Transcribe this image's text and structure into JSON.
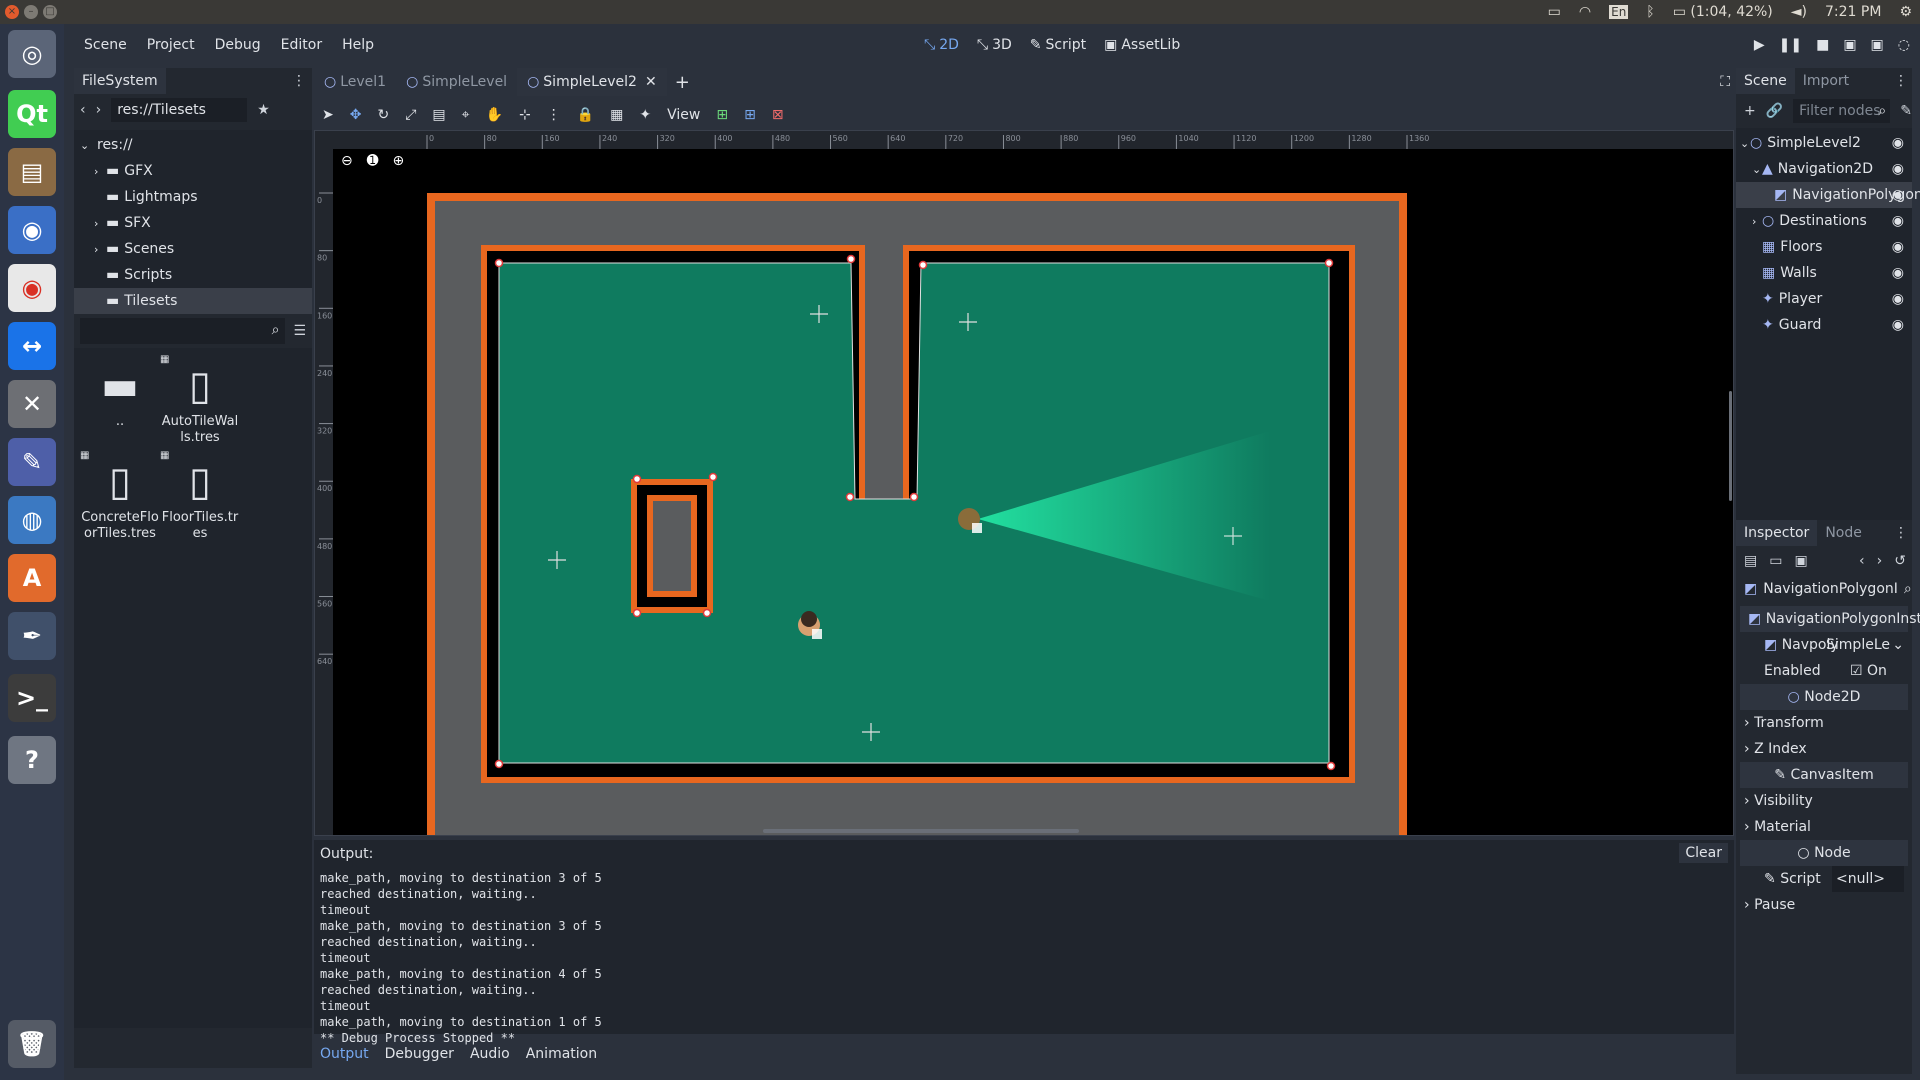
{
  "system": {
    "battery": "(1:04, 42%)",
    "clock": "7:21 PM",
    "keyboard": "En"
  },
  "menu": [
    "Scene",
    "Project",
    "Debug",
    "Editor",
    "Help"
  ],
  "modes": [
    {
      "label": "2D",
      "active": true
    },
    {
      "label": "3D",
      "active": false
    },
    {
      "label": "Script",
      "active": false
    },
    {
      "label": "AssetLib",
      "active": false
    }
  ],
  "filesystem": {
    "tab": "FileSystem",
    "path": "res://Tilesets",
    "tree": [
      {
        "label": "res://",
        "level": 0,
        "expanded": true,
        "selected": false
      },
      {
        "label": "GFX",
        "level": 1,
        "expandable": true,
        "selected": false
      },
      {
        "label": "Lightmaps",
        "level": 1,
        "expandable": false,
        "selected": false
      },
      {
        "label": "SFX",
        "level": 1,
        "expandable": true,
        "selected": false
      },
      {
        "label": "Scenes",
        "level": 1,
        "expandable": true,
        "selected": false
      },
      {
        "label": "Scripts",
        "level": 1,
        "expandable": false,
        "selected": false
      },
      {
        "label": "Tilesets",
        "level": 1,
        "expandable": false,
        "selected": true
      }
    ],
    "files": [
      {
        "label": "..",
        "type": "folder"
      },
      {
        "label": "AutoTileWalls.tres",
        "type": "file"
      },
      {
        "label": "ConcreteFloorTiles.tres",
        "type": "file"
      },
      {
        "label": "FloorTiles.tres",
        "type": "file"
      }
    ]
  },
  "scene_tabs": [
    {
      "label": "Level1",
      "active": false
    },
    {
      "label": "SimpleLevel",
      "active": false
    },
    {
      "label": "SimpleLevel2",
      "active": true
    }
  ],
  "toolbar": {
    "view_label": "View"
  },
  "ruler_labels": [
    "0",
    "80",
    "160",
    "240",
    "320",
    "400",
    "480",
    "560",
    "640",
    "720",
    "800",
    "880",
    "960",
    "1040",
    "1120",
    "1200",
    "1280",
    "1360"
  ],
  "ruler_v_labels": [
    "0",
    "80",
    "160",
    "240",
    "320",
    "400",
    "480",
    "560",
    "640"
  ],
  "scene_panel": {
    "tabs": [
      "Scene",
      "Import"
    ],
    "filter_placeholder": "Filter nodes",
    "nodes": [
      {
        "label": "SimpleLevel2",
        "level": 0,
        "icon": "node2d-icon",
        "selected": false
      },
      {
        "label": "Navigation2D",
        "level": 1,
        "icon": "navigation-icon",
        "selected": false
      },
      {
        "label": "NavigationPolygonI",
        "level": 2,
        "icon": "navpoly-icon",
        "selected": true
      },
      {
        "label": "Destinations",
        "level": 1,
        "icon": "node2d-icon",
        "selected": false
      },
      {
        "label": "Floors",
        "level": 1,
        "icon": "tilemap-icon",
        "selected": false
      },
      {
        "label": "Walls",
        "level": 1,
        "icon": "tilemap-icon",
        "selected": false
      },
      {
        "label": "Player",
        "level": 1,
        "icon": "kinematic-icon",
        "selected": false
      },
      {
        "label": "Guard",
        "level": 1,
        "icon": "kinematic-icon",
        "selected": false
      }
    ]
  },
  "inspector": {
    "tabs": [
      "Inspector",
      "Node"
    ],
    "object_label": "NavigationPolygonI",
    "class_label": "NavigationPolygonInstance",
    "navpoly_label": "Navpoly",
    "navpoly_value": "SimpleLe",
    "enabled_label": "Enabled",
    "enabled_value": "On",
    "node2d_label": "Node2D",
    "transform_label": "Transform",
    "zindex_label": "Z Index",
    "canvasitem_label": "CanvasItem",
    "visibility_label": "Visibility",
    "material_label": "Material",
    "node_label": "Node",
    "script_label": "Script",
    "script_value": "<null>",
    "pause_label": "Pause"
  },
  "output": {
    "label": "Output:",
    "clear_label": "Clear",
    "lines": [
      "make_path, moving to destination 3 of 5",
      "reached destination, waiting..",
      "timeout",
      "make_path, moving to destination 3 of 5",
      "reached destination, waiting..",
      "timeout",
      "make_path, moving to destination 4 of 5",
      "reached destination, waiting..",
      "timeout",
      "make_path, moving to destination 1 of 5",
      "** Debug Process Stopped **"
    ],
    "bottom_tabs": [
      {
        "label": "Output",
        "active": true
      },
      {
        "label": "Debugger",
        "active": false
      },
      {
        "label": "Audio",
        "active": false
      },
      {
        "label": "Animation",
        "active": false
      }
    ]
  }
}
